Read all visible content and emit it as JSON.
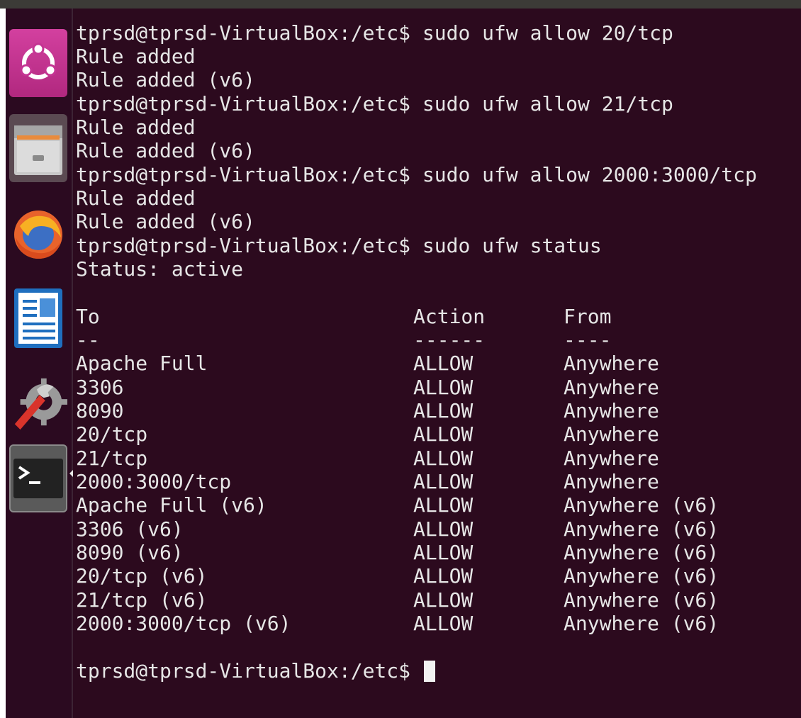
{
  "terminal": {
    "prompt": "tprsd@tprsd-VirtualBox:/etc$",
    "lines": [
      "tprsd@tprsd-VirtualBox:/etc$ sudo ufw allow 20/tcp",
      "Rule added",
      "Rule added (v6)",
      "tprsd@tprsd-VirtualBox:/etc$ sudo ufw allow 21/tcp",
      "Rule added",
      "Rule added (v6)",
      "tprsd@tprsd-VirtualBox:/etc$ sudo ufw allow 2000:3000/tcp",
      "Rule added",
      "Rule added (v6)",
      "tprsd@tprsd-VirtualBox:/etc$ sudo ufw status",
      "Status: active"
    ],
    "table": {
      "headers": [
        "To",
        "Action",
        "From"
      ],
      "separators": [
        "--",
        "------",
        "----"
      ],
      "rows": [
        [
          "Apache Full",
          "ALLOW",
          "Anywhere"
        ],
        [
          "3306",
          "ALLOW",
          "Anywhere"
        ],
        [
          "8090",
          "ALLOW",
          "Anywhere"
        ],
        [
          "20/tcp",
          "ALLOW",
          "Anywhere"
        ],
        [
          "21/tcp",
          "ALLOW",
          "Anywhere"
        ],
        [
          "2000:3000/tcp",
          "ALLOW",
          "Anywhere"
        ],
        [
          "Apache Full (v6)",
          "ALLOW",
          "Anywhere (v6)"
        ],
        [
          "3306 (v6)",
          "ALLOW",
          "Anywhere (v6)"
        ],
        [
          "8090 (v6)",
          "ALLOW",
          "Anywhere (v6)"
        ],
        [
          "20/tcp (v6)",
          "ALLOW",
          "Anywhere (v6)"
        ],
        [
          "21/tcp (v6)",
          "ALLOW",
          "Anywhere (v6)"
        ],
        [
          "2000:3000/tcp (v6)",
          "ALLOW",
          "Anywhere (v6)"
        ]
      ]
    }
  },
  "launcher": {
    "items": [
      {
        "icon": "ubuntu-logo-icon"
      },
      {
        "icon": "files-icon"
      },
      {
        "icon": "firefox-icon"
      },
      {
        "icon": "libreoffice-writer-icon"
      },
      {
        "icon": "system-settings-icon"
      },
      {
        "icon": "terminal-icon",
        "active": true
      }
    ]
  },
  "colors": {
    "terminal_bg": "#2c0a1e",
    "launcher_bg": "#2b0a20",
    "text": "#e6e6e6"
  }
}
